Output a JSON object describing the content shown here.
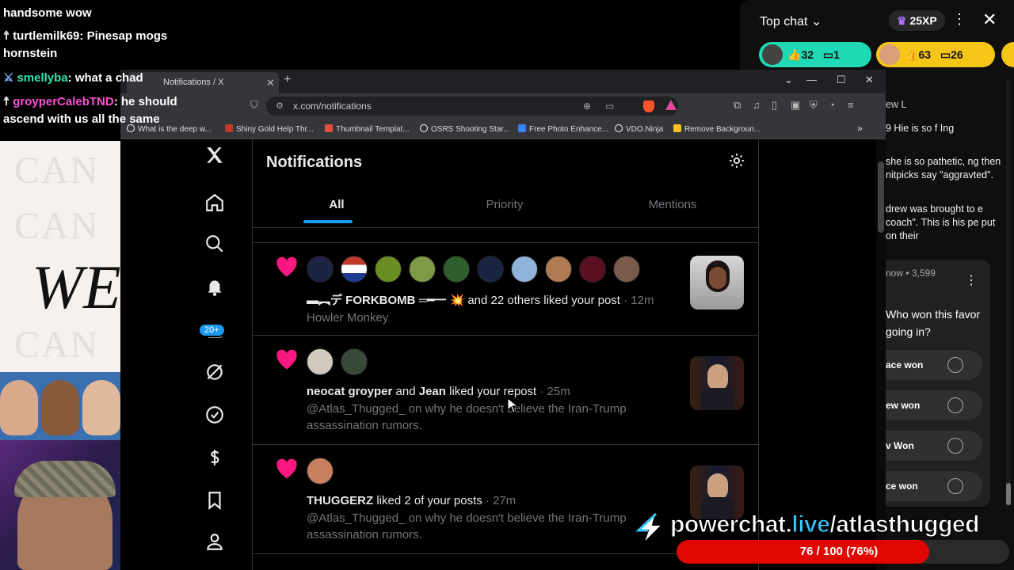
{
  "stream_chat": [
    {
      "user": "",
      "message": "handsome wow"
    },
    {
      "user": "turtlemilk69",
      "message": "Pinesap mogs hornstein"
    },
    {
      "user": "smellyba",
      "message": "what a chad"
    },
    {
      "user": "groyperCalebTND",
      "message": "he should ascend with us all the same"
    }
  ],
  "background": {
    "headline": "WE",
    "faint_text": "CAN"
  },
  "browser": {
    "tab_title": "Notifications / X",
    "url": "x.com/notifications",
    "bookmarks": [
      {
        "label": "What is the deep w...",
        "color": "#ffffff"
      },
      {
        "label": "Shiny Gold Help Thr...",
        "color": "#c0392b"
      },
      {
        "label": "Thumbnail Templat...",
        "color": "#e74c3c"
      },
      {
        "label": "OSRS Shooting Star...",
        "color": "#ffffff"
      },
      {
        "label": "Free Photo Enhance...",
        "color": "#3b82f6"
      },
      {
        "label": "VDO.Ninja",
        "color": "#ffffff"
      },
      {
        "label": "Remove Backgroun...",
        "color": "#f5c518"
      }
    ]
  },
  "x": {
    "page_title": "Notifications",
    "tabs": [
      "All",
      "Priority",
      "Mentions"
    ],
    "active_tab": "All",
    "nav_badge": "20+",
    "notifications": [
      {
        "actors": "▬︻デ FORKBOMB ═━一 💥",
        "action": "and 22 others liked your post",
        "time": "· 12m",
        "subtext": "Howler Monkey"
      },
      {
        "actor1": "neocat groyper",
        "and": "and",
        "actor2": "Jean",
        "action": "liked your repost",
        "time": "· 25m",
        "subtext": "@Atlas_Thugged_ on why he doesn't believe the Iran-Trump assassination rumors."
      },
      {
        "actor1": "THUGGERZ",
        "action": "liked 2 of your posts",
        "time": "· 27m",
        "subtext": "@Atlas_Thugged_ on why he doesn't believe the Iran-Trump assassination rumors."
      }
    ]
  },
  "youtube_chat": {
    "title": "Top chat",
    "xp": "25XP",
    "chips": [
      {
        "likes": "32",
        "comments": "1",
        "color": "#1ed9b4"
      },
      {
        "likes": "63",
        "comments": "26",
        "color": "#f5c518"
      }
    ],
    "messages": [
      {
        "name": "ew L",
        "text": ""
      },
      {
        "name": "",
        "text": "9  Hie is so f Ing"
      },
      {
        "name": "",
        "text": "she is so pathetic, ng then nitpicks say \"aggravted\"."
      },
      {
        "name": "",
        "text": "drew was brought to e coach\". This is his pe put on their"
      }
    ],
    "poll": {
      "meta": "now • 3,599",
      "question": "Who won this favor going in?",
      "options": [
        "ace won",
        "ew won",
        "v Won",
        "ce won"
      ]
    }
  },
  "promo": {
    "text_start": "powerchat.",
    "text_highlight": "live",
    "text_end": "/atlasthugged",
    "goal_label": "76 / 100 (76%)",
    "goal_fraction": 0.76
  }
}
